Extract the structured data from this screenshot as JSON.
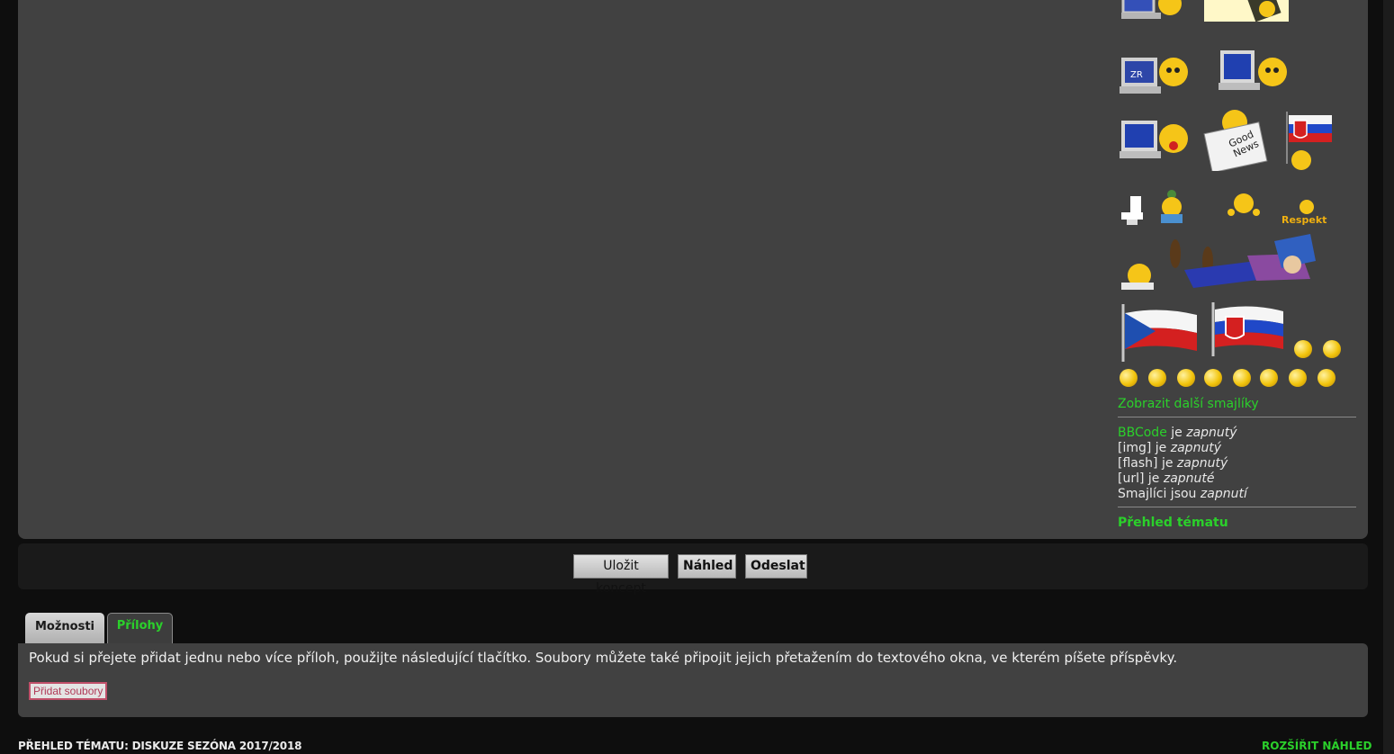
{
  "sidebar": {
    "more_smilies": "Zobrazit další smajlíky",
    "bbcode": {
      "bbcode_link": "BBCode",
      "bbcode_mid": " je ",
      "bbcode_state": "zapnutý",
      "img_label": "[img] je ",
      "img_state": "zapnutý",
      "flash_label": "[flash] je ",
      "flash_state": "zapnutý",
      "url_label": "[url] je ",
      "url_state": "zapnuté",
      "smilies_label": "Smajlíci jsou ",
      "smilies_state": "zapnutí"
    },
    "topic_review": "Přehled tématu"
  },
  "buttons": {
    "save_draft": "Uložit koncept",
    "preview": "Náhled",
    "submit": "Odeslat"
  },
  "tabs": {
    "options": "Možnosti",
    "attachments": "Přílohy"
  },
  "attachments": {
    "info": "Pokud si přejete přidat jednu nebo více příloh, použijte následující tlačítko. Soubory můžete také připojit jejich přetažením do textového okna, ve kterém píšete příspěvky.",
    "add_files": "Přidat soubory"
  },
  "footer": {
    "topic_title": "PŘEHLED TÉMATU: DISKUZE SEZÓNA 2017/2018",
    "expand": "ROZŠÍŘIT NÁHLED"
  },
  "colors": {
    "link_green": "#2bd02b",
    "panel": "#414141",
    "background": "#0e0e0e"
  },
  "icons": [
    "computer-smiley-icon",
    "sign-smiley-icon",
    "computer-smiley-icon",
    "good-news-smiley-icon",
    "slovak-flag-smiley-icon",
    "toilet-smiley-icon",
    "respekt-smiley-icon",
    "sleeping-reader-smiley-icon",
    "czech-flag-icon",
    "slovak-flag-icon"
  ]
}
